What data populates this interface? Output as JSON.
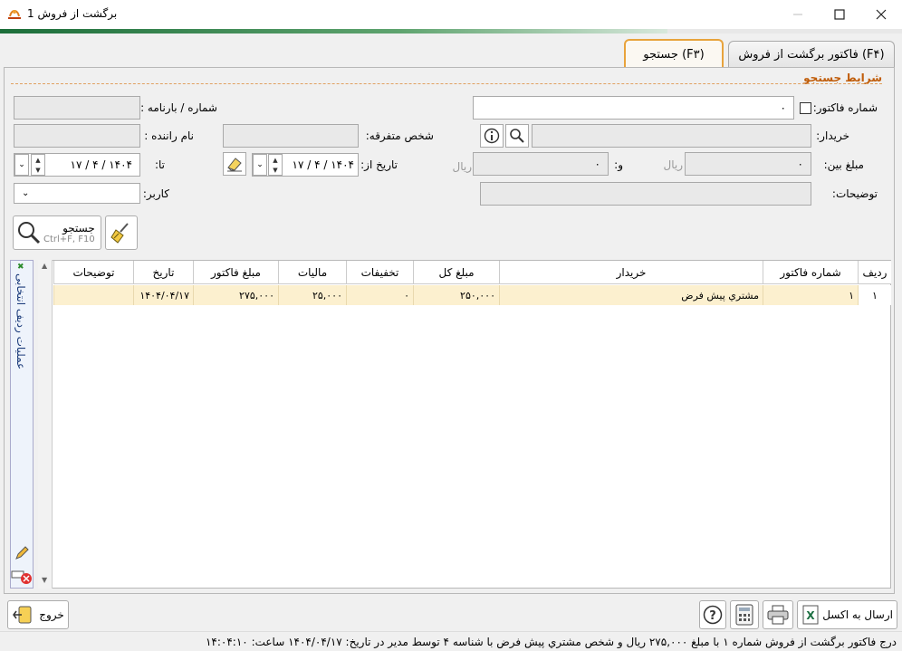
{
  "window": {
    "title": "برگشت از فروش 1"
  },
  "tabs": [
    {
      "label": "فاکتور برگشت از فروش (F۴)"
    },
    {
      "label": "جستجو (F۳)"
    }
  ],
  "search": {
    "section_title": "شرایط جستجو",
    "invoice_no_label": "شماره فاکتور:",
    "invoice_no_value": "۰",
    "waybill_label": "شماره / بارنامه :",
    "buyer_label": "خریدار:",
    "misc_person_label": "شخص متفرقه:",
    "driver_label": "نام راننده :",
    "amount_between_label": "مبلغ بین:",
    "amount_from": "۰",
    "and_label": "و:",
    "amount_to": "۰",
    "rial": "ریال",
    "date_from_label": "تاریخ از:",
    "date_from": "۱۴۰۴ / ۴ / ۱۷",
    "date_to_label": "تا:",
    "date_to": "۱۴۰۴ / ۴ / ۱۷",
    "desc_label": "توضیحات:",
    "user_label": "کاربر:",
    "search_button": "جستجو",
    "search_shortcut": "Ctrl+F, F10"
  },
  "side_panel": {
    "label": "عملیات ردیف انتخابی"
  },
  "grid": {
    "columns": [
      "ردیف",
      "شماره فاکتور",
      "خریدار",
      "مبلغ کل",
      "تخفیفات",
      "مالیات",
      "مبلغ فاکتور",
      "تاریخ",
      "توضیحات"
    ],
    "rows": [
      [
        "۱",
        "۱",
        "مشتري پيش فرض",
        "۲۵۰,۰۰۰",
        "۰",
        "۲۵,۰۰۰",
        "۲۷۵,۰۰۰",
        "۱۴۰۴/۰۴/۱۷",
        ""
      ]
    ]
  },
  "footer": {
    "exit_button": "خروج",
    "excel_button": "ارسال به اکسل"
  },
  "status_text": "درج فاکتور برگشت از فروش شماره ۱ با مبلغ ۲۷۵,۰۰۰ ریال و شخص مشتري پيش فرض با شناسه ۴ توسط مدیر در تاریخ: ۱۴۰۴/۰۴/۱۷ ساعت: ۱۴:۰۴:۱۰",
  "progress_fraction": 0.74
}
